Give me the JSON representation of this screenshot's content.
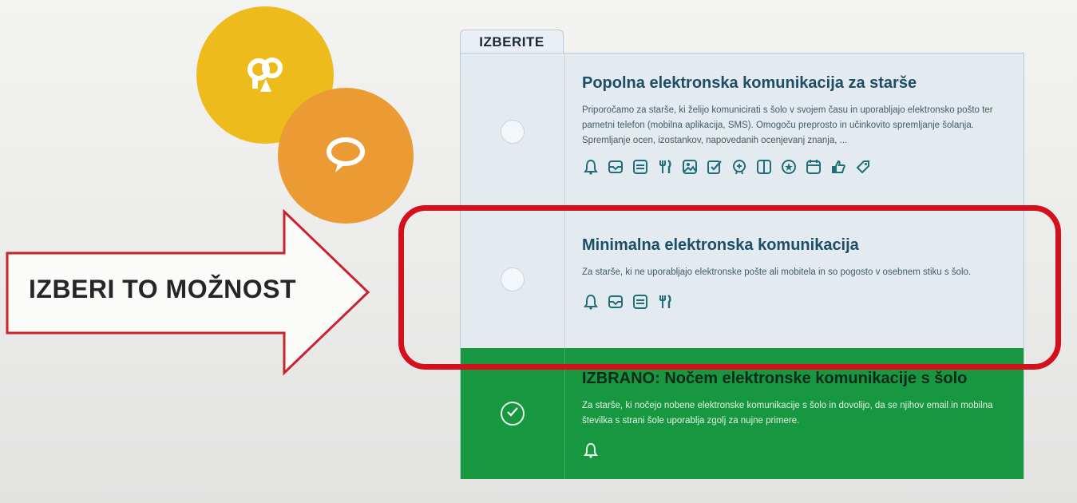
{
  "colors": {
    "accent_yellow": "#eebb1c",
    "accent_orange": "#eb9a34",
    "highlight_red": "#d4101d",
    "selected_green": "#17973f",
    "icon_teal": "#1f6e7a"
  },
  "decor": {
    "yellow_circle_icon": "parents-icon",
    "orange_circle_icon": "speech-bubble-icon"
  },
  "instruction": {
    "label": "IZBERI TO MOŽNOST"
  },
  "tab": {
    "label": "IZBERITE"
  },
  "options": [
    {
      "title": "Popolna elektronska komunikacija za starše",
      "description": "Priporočamo za starše, ki želijo komunicirati s šolo v svojem času in uporabljajo elektronsko pošto ter pametni telefon (mobilna aplikacija, SMS). Omogoču preprosto in učinkovito spremljanje šolanja. Spremljanje ocen, izostankov, napovedanih ocenjevanj znanja, ...",
      "selected": false,
      "icons": [
        "bell-icon",
        "mail-icon",
        "sms-icon",
        "meals-icon",
        "photo-icon",
        "checklist-icon",
        "badge-icon",
        "book-icon",
        "star-icon",
        "calendar-icon",
        "like-icon",
        "tag-icon"
      ]
    },
    {
      "title": "Minimalna elektronska komunikacija",
      "description": "Za starše, ki ne uporabljajo elektronske pošte ali mobitela in so pogosto v osebnem stiku s šolo.",
      "selected": false,
      "icons": [
        "bell-icon",
        "mail-icon",
        "sms-icon",
        "meals-icon"
      ]
    },
    {
      "title": "IZBRANO: Nočem elektronske komunikacije s šolo",
      "description": "Za starše, ki nočejo nobene elektronske komunikacije s šolo in dovolijo, da se njihov email in mobilna številka s strani šole uporablja zgolj za nujne primere.",
      "selected": true,
      "icons": [
        "bell-icon"
      ]
    }
  ]
}
